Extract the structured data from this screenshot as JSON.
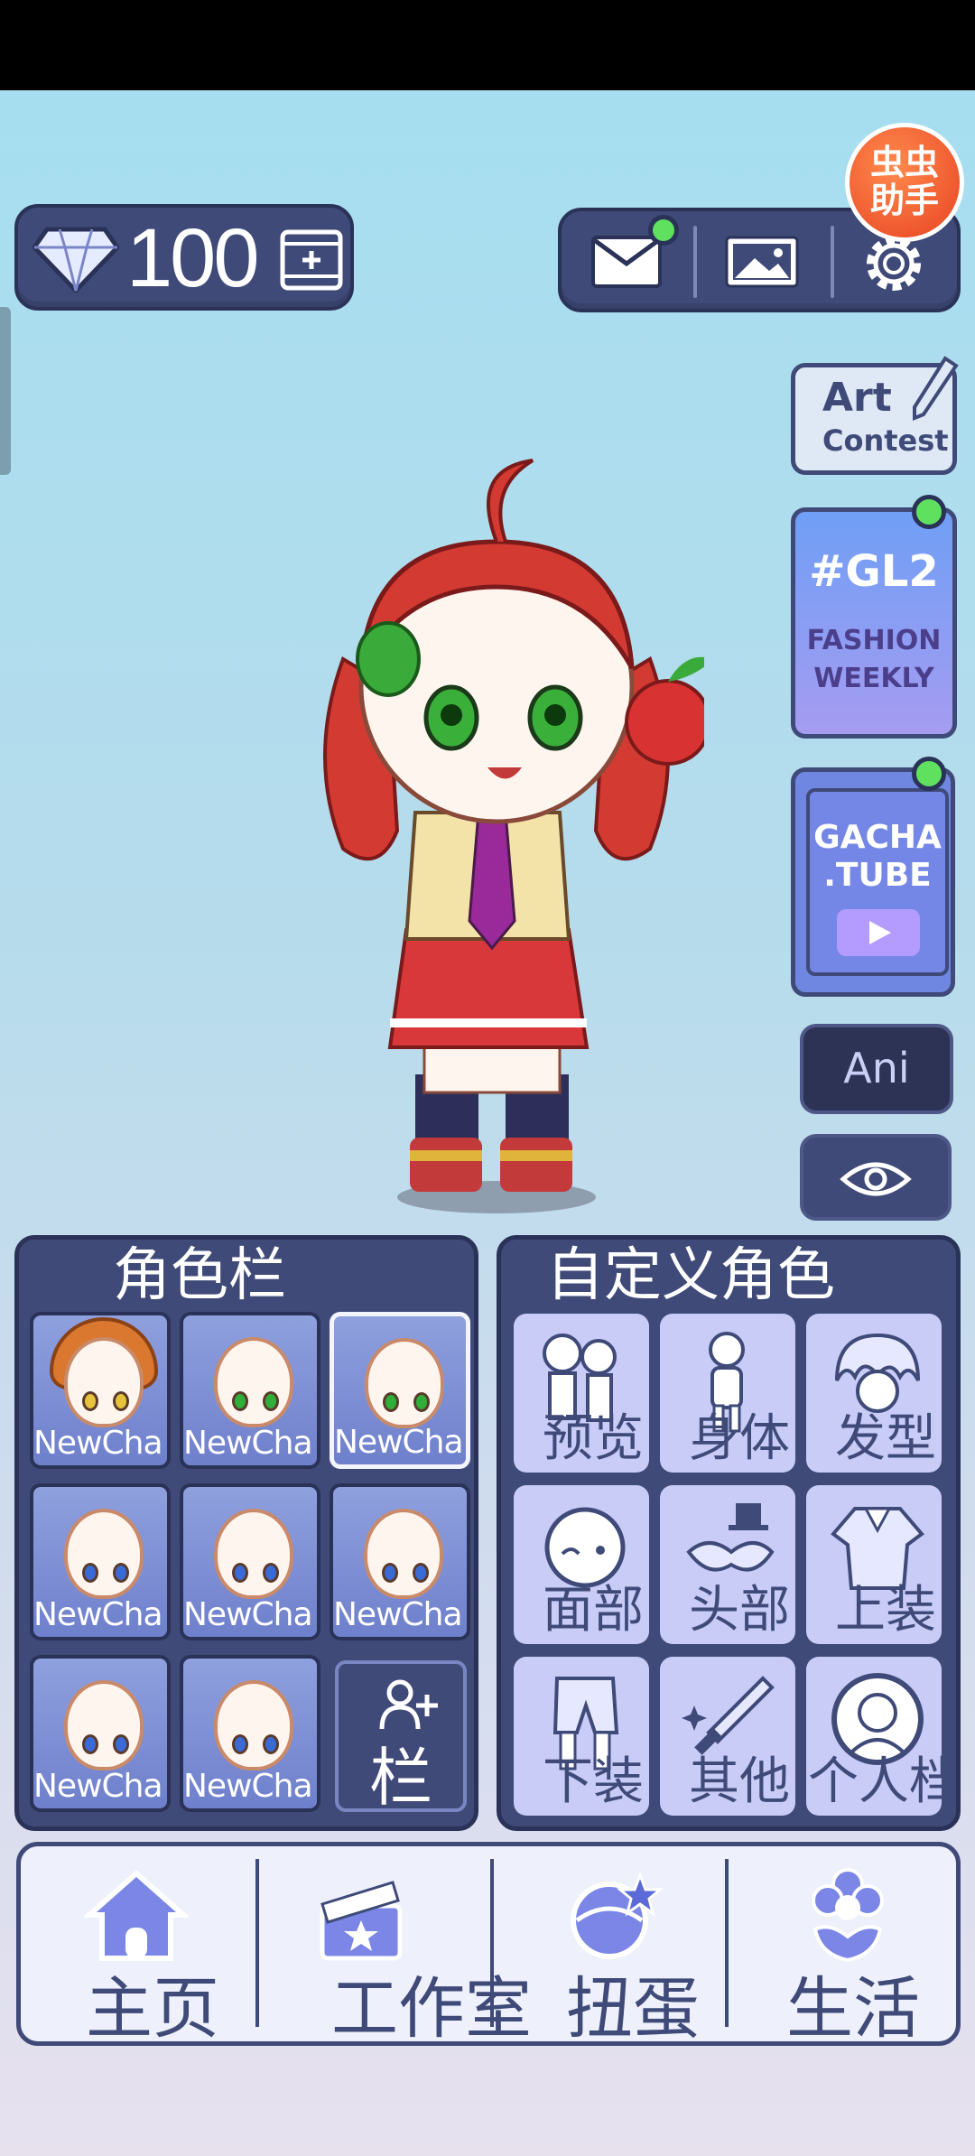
{
  "currency": {
    "gems": "100"
  },
  "character_panel": {
    "title": "角色栏",
    "slots": [
      {
        "label": "NewCha",
        "eye_color": "#e6c33a",
        "hair": true
      },
      {
        "label": "NewCha",
        "eye_color": "#2fae3a"
      },
      {
        "label": "NewCha",
        "eye_color": "#2fae3a",
        "selected": true
      },
      {
        "label": "NewCha",
        "eye_color": "#3a6ad6"
      },
      {
        "label": "NewCha",
        "eye_color": "#3a6ad6"
      },
      {
        "label": "NewCha",
        "eye_color": "#3a6ad6"
      },
      {
        "label": "NewCha",
        "eye_color": "#3a6ad6"
      },
      {
        "label": "NewCha",
        "eye_color": "#3a6ad6"
      }
    ],
    "add_slot_label": "栏"
  },
  "customize_panel": {
    "title": "自定义角色",
    "categories": [
      "预览",
      "身体",
      "发型",
      "面部",
      "头部",
      "上装",
      "下装",
      "其他",
      "个人档"
    ]
  },
  "side": {
    "art_contest": {
      "line1": "Art",
      "line2": "Contest"
    },
    "fashion": {
      "title": "#GL2",
      "line1": "FASHION",
      "line2": "WEEKLY"
    },
    "gachatube": {
      "line1": "GACHA",
      "line2": ".TUBE"
    },
    "ani_label": "Ani"
  },
  "helper_badge": {
    "line1": "虫虫",
    "line2": "助手"
  },
  "nav": [
    "主页",
    "工作室",
    "扭蛋",
    "生活"
  ],
  "colors": {
    "panel": "#3f4a78",
    "accent_green": "#5fe05f",
    "badge": "#e84322"
  }
}
